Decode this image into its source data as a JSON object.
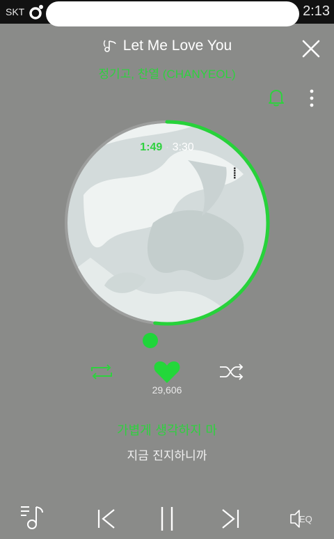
{
  "status_bar": {
    "carrier": "SKT",
    "time": "2:13"
  },
  "song": {
    "title": "Let Me Love You",
    "artist": "정기고, 찬열 (CHANYEOL)"
  },
  "playback": {
    "current_time": "1:49",
    "separator": "·",
    "total_time": "3:30",
    "progress_fraction": 0.519
  },
  "likes": {
    "count": "29,606"
  },
  "lyrics": {
    "current_line": "가볍게 생각하지 마",
    "next_line": "지금 진지하니까"
  },
  "controls": {
    "eq_label": "EQ"
  },
  "colors": {
    "accent": "#2fd13f",
    "background": "#8a8b89",
    "status_bar": "#121212"
  },
  "icons": [
    "music-note-icon",
    "close-icon",
    "bell-icon",
    "more-vert-icon",
    "repeat-icon",
    "heart-icon",
    "shuffle-icon",
    "playlist-icon",
    "previous-icon",
    "pause-icon",
    "next-icon",
    "eq-icon"
  ]
}
